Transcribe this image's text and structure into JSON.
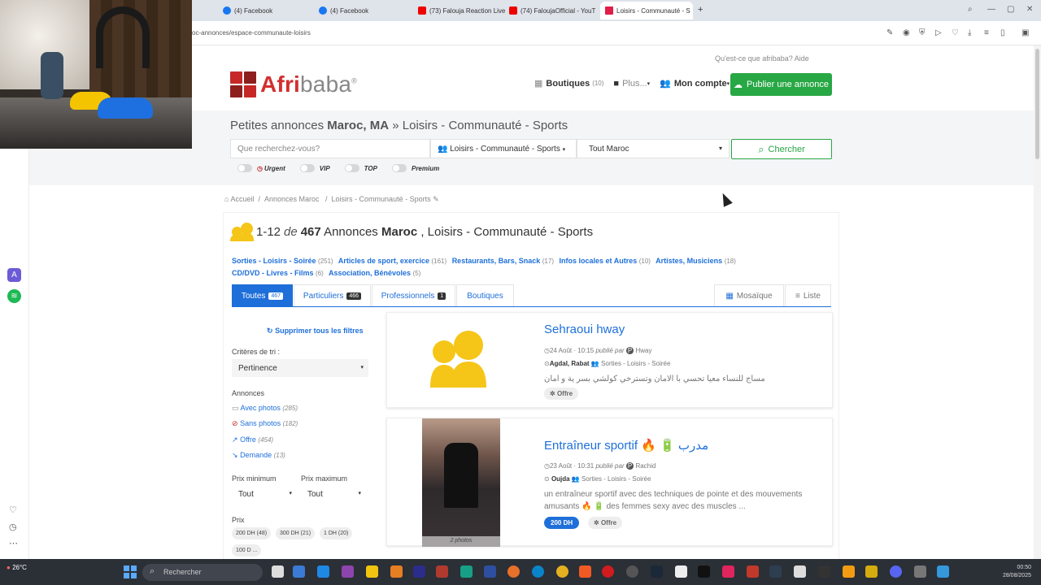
{
  "browser": {
    "tabs": [
      {
        "label": "(4) Facebook",
        "fav": "fb",
        "active": false
      },
      {
        "label": "(4) Facebook",
        "fav": "fb",
        "active": false
      },
      {
        "label": "(73) Falouja Reaction Live",
        "fav": "yt",
        "active": false
      },
      {
        "label": "(74) FaloujaOfficial - YouT",
        "fav": "yt",
        "active": false
      },
      {
        "label": "Loisirs - Communauté - S",
        "fav": "af",
        "active": true
      }
    ],
    "new_tab": "+",
    "url": "oc-annonces/espace-communaute-loisirs"
  },
  "header": {
    "top_links": "Qu'est-ce que afribaba?   Aide",
    "logo_part1": "Afri",
    "logo_part2": "baba",
    "logo_tm": "®",
    "nav": {
      "boutiques": "Boutiques",
      "boutiques_count": "(10)",
      "plus": "Plus...",
      "mon_compte": "Mon compte"
    },
    "publish_label": "Publier une annonce"
  },
  "search": {
    "title_prefix": "Petites annonces ",
    "title_region": "Maroc, MA",
    "title_suffix": " » Loisirs - Communauté - Sports",
    "placeholder": "Que recherchez-vous?",
    "category": "Loisirs - Communauté - Sports",
    "location": "Tout Maroc",
    "button": "Chercher",
    "filters": [
      "Urgent",
      "VIP",
      "TOP",
      "Premium"
    ]
  },
  "breadcrumb": {
    "home": "Accueil",
    "level1": "Annonces Maroc",
    "level2": "Loisirs - Communauté - Sports"
  },
  "listing": {
    "range": "1-12",
    "de": "de",
    "count": "467",
    "annonces": " Annonces ",
    "country": "Maroc",
    "category": " , Loisirs - Communauté - Sports",
    "subcats": [
      {
        "name": "Sorties - Loisirs - Soirée",
        "count": "(251)"
      },
      {
        "name": "Articles de sport, exercice",
        "count": "(161)"
      },
      {
        "name": "Restaurants, Bars, Snack",
        "count": "(17)"
      },
      {
        "name": "Infos locales et Autres",
        "count": "(10)"
      },
      {
        "name": "Artistes, Musiciens",
        "count": "(18)"
      },
      {
        "name": "CD/DVD - Livres - Films",
        "count": "(6)"
      },
      {
        "name": "Association, Bénévoles",
        "count": "(5)"
      }
    ],
    "tabs": [
      {
        "label": "Toutes",
        "badge": "467"
      },
      {
        "label": "Particuliers",
        "badge": "466"
      },
      {
        "label": "Professionnels",
        "badge": "1"
      },
      {
        "label": "Boutiques",
        "badge": ""
      }
    ],
    "view_mosaic": "Mosaïque",
    "view_list": "Liste"
  },
  "sidebar": {
    "clear": "Supprimer tous les filtres",
    "sort_label": "Critères de tri :",
    "sort_value": "Pertinence",
    "annonces_label": "Annonces",
    "links": [
      {
        "label": "Avec photos",
        "count": "(285)"
      },
      {
        "label": "Sans photos",
        "count": "(182)"
      },
      {
        "label": "Offre",
        "count": "(454)"
      },
      {
        "label": "Demande",
        "count": "(13)"
      }
    ],
    "prix_min_label": "Prix minimum",
    "prix_max_label": "Prix maximum",
    "prix_min": "Tout",
    "prix_max": "Tout",
    "prix_label": "Prix",
    "chips": [
      "200 DH (48)",
      "300 DH (21)",
      "1 DH (20)",
      "100 D ..."
    ]
  },
  "ads": [
    {
      "title": "Sehraoui hway",
      "date": "24 Août · 10:15",
      "publie_par": "publié par",
      "author": "Hway",
      "location": "Agdal, Rabat",
      "category": "Sorties - Loisirs - Soirée",
      "desc": "مساج للنساء معيا تحسي با الامان وتسترخي كولشي بسر ية و امان",
      "type": "Offre"
    },
    {
      "title": "Entraîneur sportif 🔥 🔋 مدرب",
      "date": "23 Août · 10:31",
      "publie_par": "publié par",
      "author": "Rachid",
      "location": "Oujda",
      "category": "Sorties - Loisirs - Soirée",
      "desc": "un entraîneur sportif avec des techniques de pointe et des mouvements amusants 🔥 🔋 des femmes sexy avec des muscles ...",
      "price": "200 DH",
      "type": "Offre",
      "photos": "2 photos"
    }
  ],
  "taskbar": {
    "search": "Rechercher",
    "weather": "26°C",
    "time": "00:50",
    "date": "28/08/2025"
  },
  "colors": {
    "accent": "#1e6fd9",
    "green": "#28a745",
    "brand_red": "#d32f2f"
  }
}
